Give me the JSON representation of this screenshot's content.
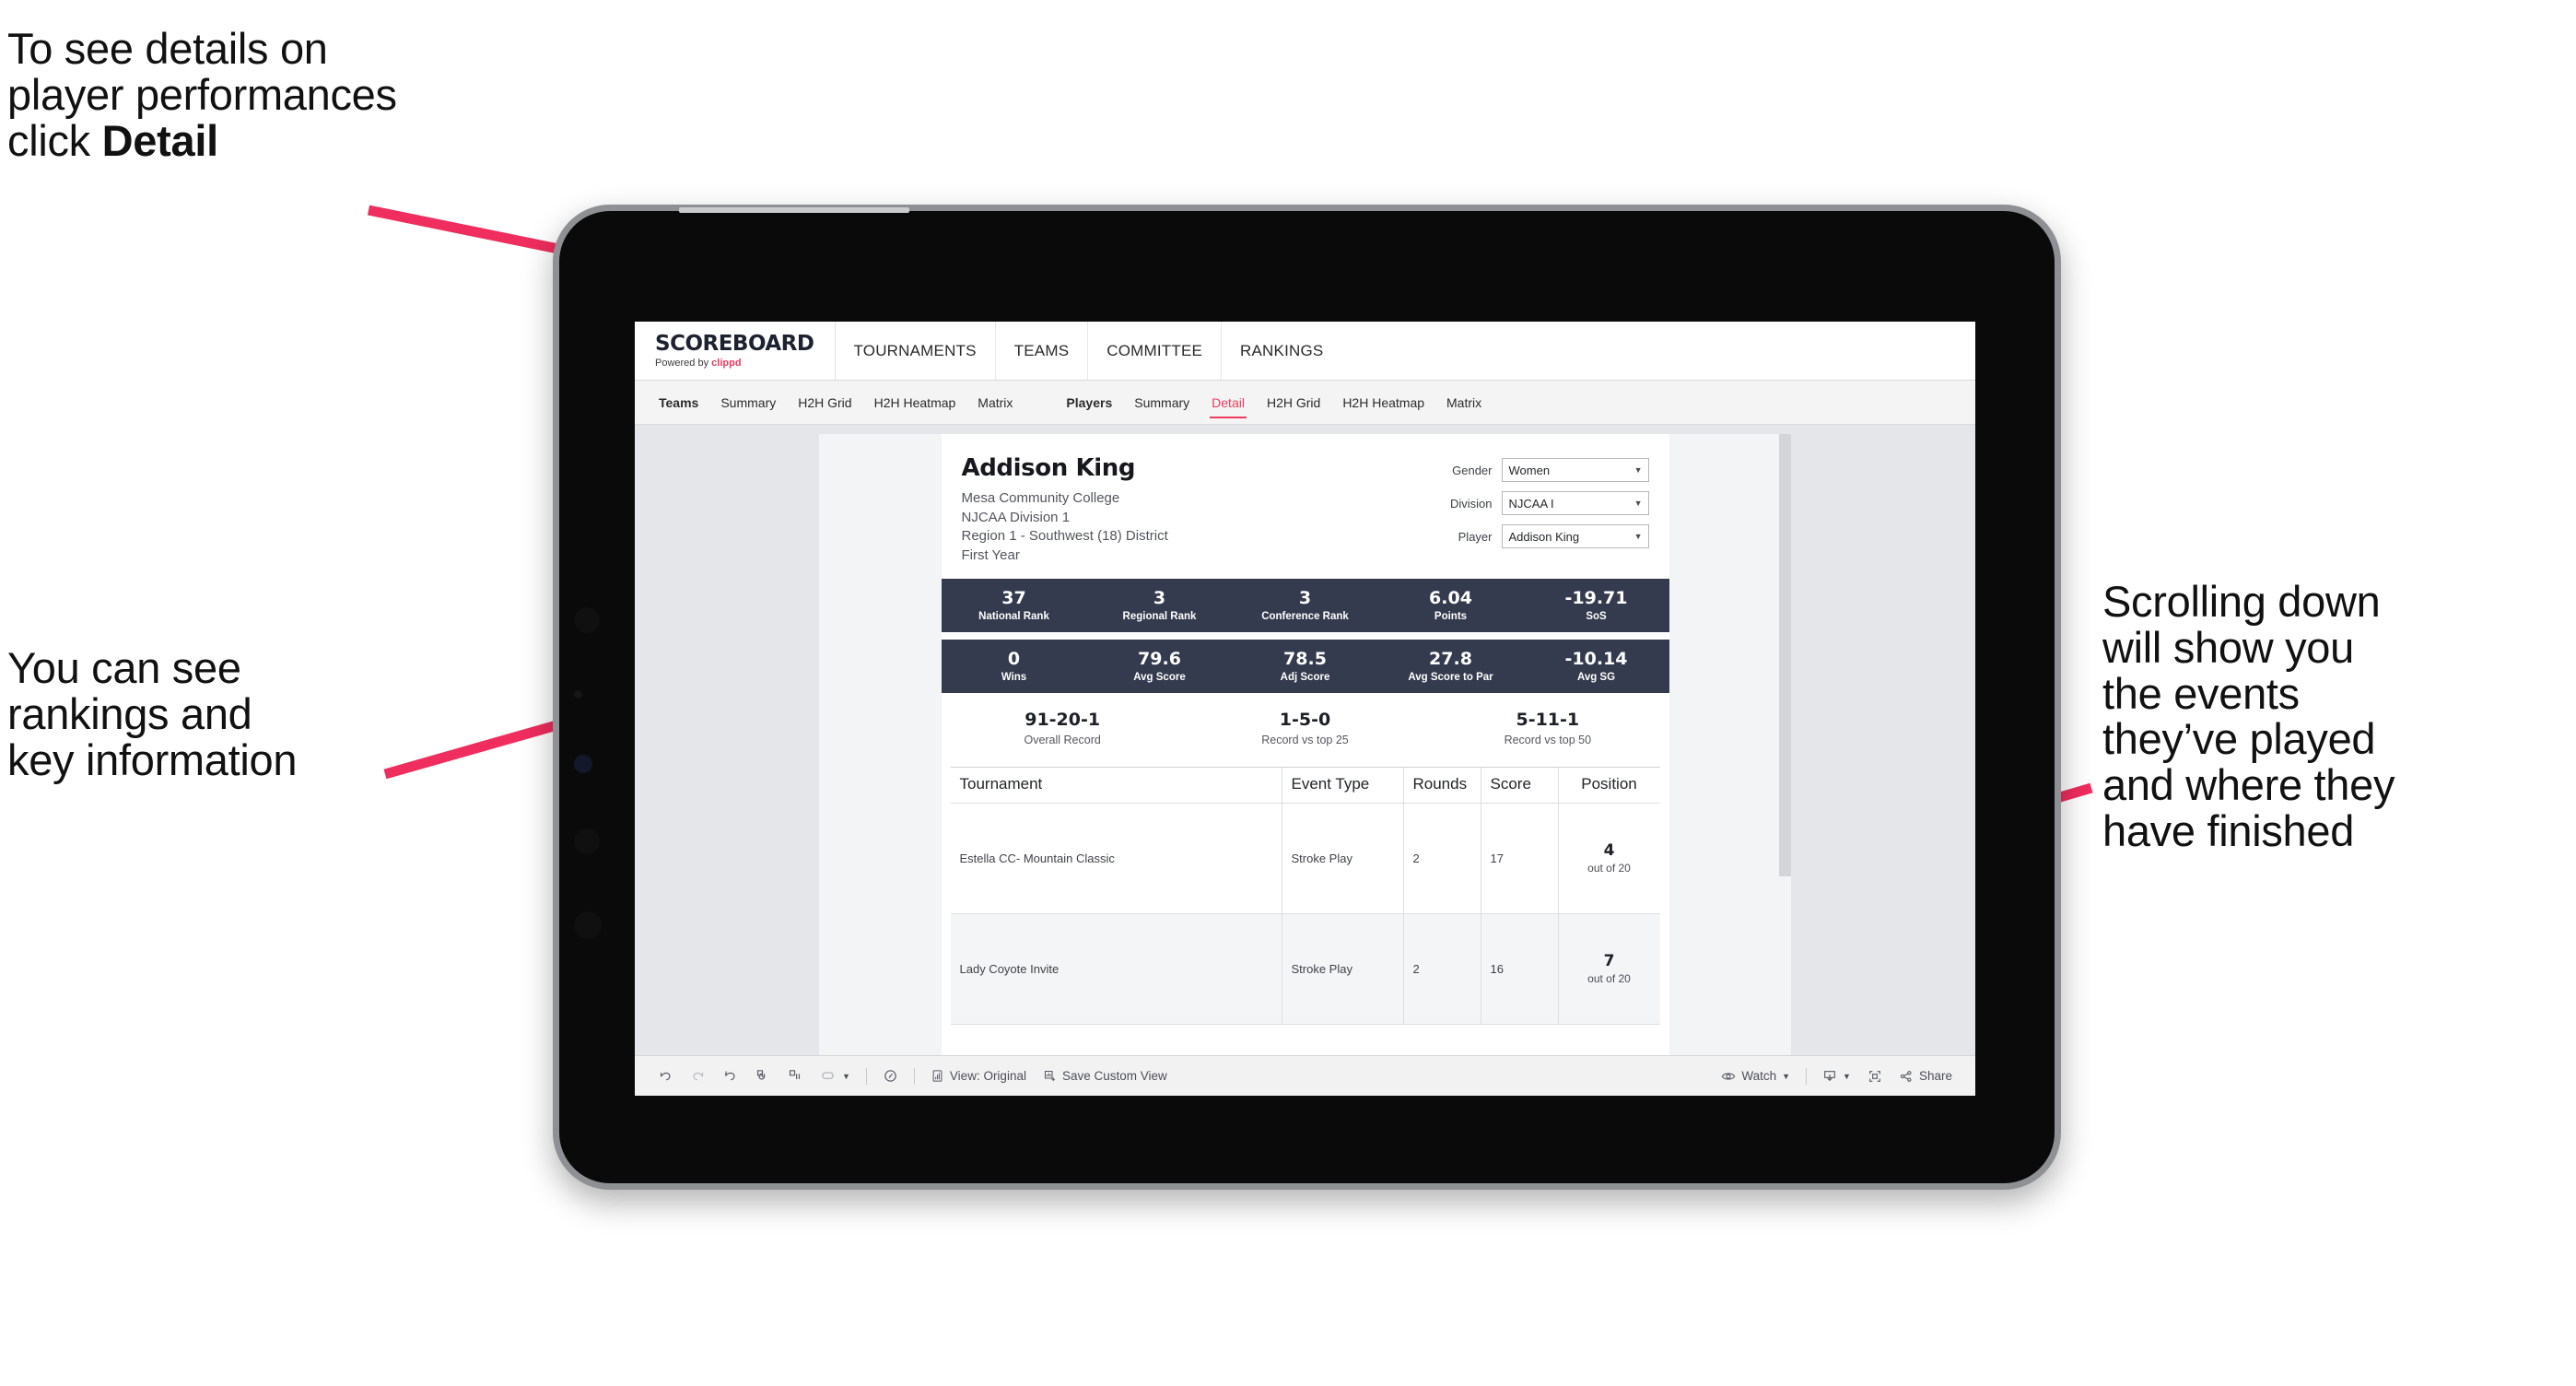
{
  "annotations": {
    "detail_note": {
      "text_before": "To see details on\nplayer performances\nclick ",
      "bold": "Detail"
    },
    "ranking_note": "You can see\nrankings and\nkey information",
    "scroll_note": "Scrolling down\nwill show you\nthe events\nthey’ve played\nand where they\nhave finished",
    "arrow_color": "#ef2d5e"
  },
  "app": {
    "brand": {
      "title": "SCOREBOARD",
      "powered_prefix": "Powered by ",
      "powered_brand": "clippd"
    },
    "top_nav": [
      "TOURNAMENTS",
      "TEAMS",
      "COMMITTEE",
      "RANKINGS"
    ],
    "sub_nav": {
      "teams_group": {
        "head": "Teams",
        "items": [
          "Summary",
          "H2H Grid",
          "H2H Heatmap",
          "Matrix"
        ]
      },
      "players_group": {
        "head": "Players",
        "items": [
          "Summary",
          "Detail",
          "H2H Grid",
          "H2H Heatmap",
          "Matrix"
        ],
        "active": "Detail"
      }
    }
  },
  "player": {
    "name": "Addison King",
    "lines": [
      "Mesa Community College",
      "NJCAA Division 1",
      "Region 1 - Southwest (18) District",
      "First Year"
    ]
  },
  "filters": [
    {
      "label": "Gender",
      "value": "Women",
      "icon": "chevron-down-icon"
    },
    {
      "label": "Division",
      "value": "NJCAA I",
      "icon": "chevron-down-icon"
    },
    {
      "label": "Player",
      "value": "Addison King",
      "icon": "chevron-down-icon"
    }
  ],
  "stats_band_1": [
    {
      "value": "37",
      "label": "National Rank"
    },
    {
      "value": "3",
      "label": "Regional Rank"
    },
    {
      "value": "3",
      "label": "Conference Rank"
    },
    {
      "value": "6.04",
      "label": "Points"
    },
    {
      "value": "-19.71",
      "label": "SoS"
    }
  ],
  "stats_band_2": [
    {
      "value": "0",
      "label": "Wins"
    },
    {
      "value": "79.6",
      "label": "Avg Score"
    },
    {
      "value": "78.5",
      "label": "Adj Score"
    },
    {
      "value": "27.8",
      "label": "Avg Score to Par"
    },
    {
      "value": "-10.14",
      "label": "Avg SG"
    }
  ],
  "records": [
    {
      "value": "91-20-1",
      "label": "Overall Record"
    },
    {
      "value": "1-5-0",
      "label": "Record vs top 25"
    },
    {
      "value": "5-11-1",
      "label": "Record vs top 50"
    }
  ],
  "table": {
    "columns": [
      "Tournament",
      "Event Type",
      "Rounds",
      "Score",
      "Position"
    ],
    "rows": [
      {
        "tournament": "Estella CC- Mountain Classic",
        "event_type": "Stroke Play",
        "rounds": "2",
        "score": "17",
        "position": "4",
        "position_sub": "out of 20"
      },
      {
        "tournament": "Lady Coyote Invite",
        "event_type": "Stroke Play",
        "rounds": "2",
        "score": "16",
        "position": "7",
        "position_sub": "out of 20"
      }
    ]
  },
  "toolbar": {
    "undo": "undo-icon",
    "redo": "redo-icon",
    "revert": "revert-icon",
    "refresh": "refresh-data-icon",
    "pause": "pause-updates-icon",
    "device": "device-preview-icon",
    "alerts": "data-details-icon",
    "view_label": "View: Original",
    "save_label": "Save Custom View",
    "watch_label": "Watch",
    "download": "download-icon",
    "fullscreen": "full-screen-icon",
    "share_label": "Share"
  },
  "colors": {
    "accent_pink": "#ee3a5d",
    "band_navy": "#353b4e",
    "viz_bg": "#e4e6ea"
  }
}
